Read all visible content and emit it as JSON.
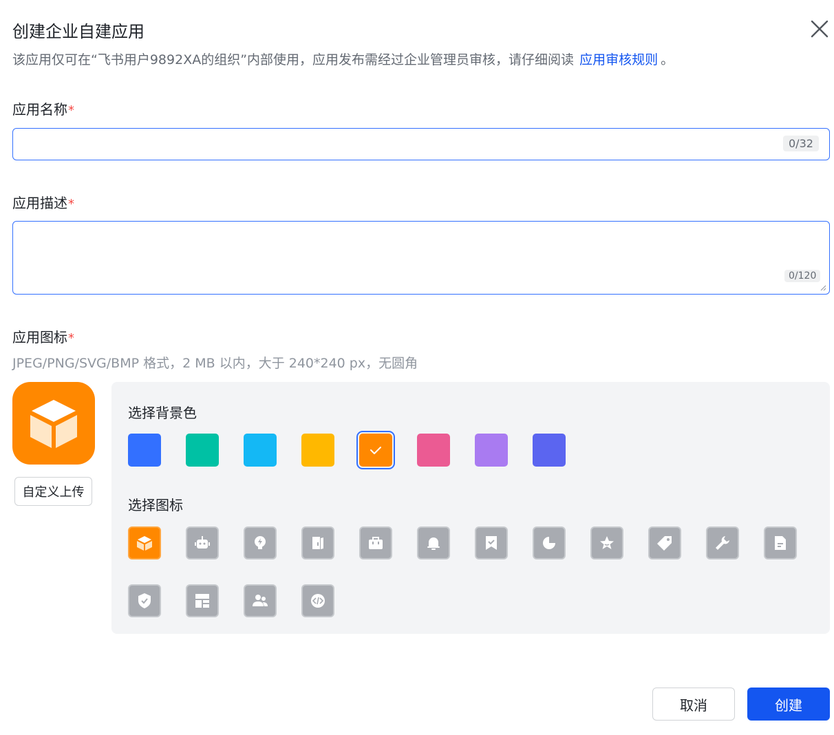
{
  "dialog": {
    "title": "创建企业自建应用",
    "subtitle_text": "该应用仅可在“飞书用户9892XA的组织”内部使用，应用发布需经过企业管理员审核，请仔细阅读",
    "subtitle_link": "应用审核规则",
    "subtitle_tail": "。"
  },
  "fields": {
    "name": {
      "label": "应用名称",
      "required_mark": "*",
      "value": "",
      "counter": "0/32"
    },
    "description": {
      "label": "应用描述",
      "required_mark": "*",
      "value": "",
      "counter": "0/120"
    },
    "icon": {
      "label": "应用图标",
      "required_mark": "*",
      "hint": "JPEG/PNG/SVG/BMP 格式，2 MB 以内，大于 240*240 px，无圆角"
    }
  },
  "upload_button": "自定义上传",
  "picker": {
    "bg_label": "选择背景色",
    "icon_label": "选择图标",
    "colors": [
      "#3370ff",
      "#00c1a4",
      "#14b8f5",
      "#ffb800",
      "#ff8800",
      "#eb5b93",
      "#a97bf1",
      "#5b65f0"
    ],
    "selected_color_index": 4,
    "icons": [
      "cube-icon",
      "robot-icon",
      "lightbulb-icon",
      "book-icon",
      "briefcase-icon",
      "bell-icon",
      "bookmark-check-icon",
      "pie-chart-icon",
      "star-icon",
      "tag-icon",
      "wrench-icon",
      "document-icon",
      "shield-check-icon",
      "layout-icon",
      "users-icon",
      "code-icon"
    ],
    "selected_icon_index": 0
  },
  "buttons": {
    "cancel": "取消",
    "create": "创建"
  },
  "colors": {
    "accent": "#1456f0",
    "required": "#f54a45",
    "selected_bg": "#ff8800"
  }
}
